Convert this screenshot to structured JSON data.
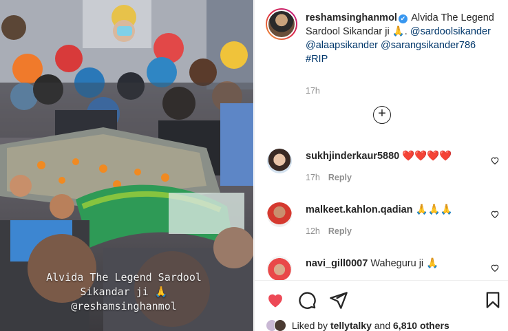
{
  "media": {
    "overlay_lines": [
      "Alvida The Legend Sardool",
      "Sikandar ji 🙏",
      "@reshamsinghanmol"
    ]
  },
  "caption": {
    "username": "reshamsinghanmol",
    "verified_icon": "✔",
    "text_1": "Alvida The",
    "text_2": "Legend Sardool Sikandar ji 🙏.",
    "mention_1": "@sardoolsikander",
    "mention_2": "@alaapsikander",
    "mention_3": "@sarangsikander786",
    "hashtag": "#RIP",
    "time": "17h"
  },
  "load_more_icon": "+",
  "comments": [
    {
      "username": "sukhjinderkaur5880",
      "text": "❤️❤️❤️❤️",
      "time": "17h",
      "reply": "Reply"
    },
    {
      "username": "malkeet.kahlon.qadian",
      "text": "🙏🙏🙏",
      "time": "12h",
      "reply": "Reply"
    },
    {
      "username": "navi_gill0007",
      "text": "Waheguru ji 🙏",
      "time": "",
      "reply": ""
    }
  ],
  "likes": {
    "prefix": "Liked by",
    "user": "tellytalky",
    "connector": "and",
    "others": "6,810 others"
  },
  "colors": {
    "like_red": "#ed4956",
    "link_blue": "#00376b",
    "meta_gray": "#8e8e8e"
  }
}
